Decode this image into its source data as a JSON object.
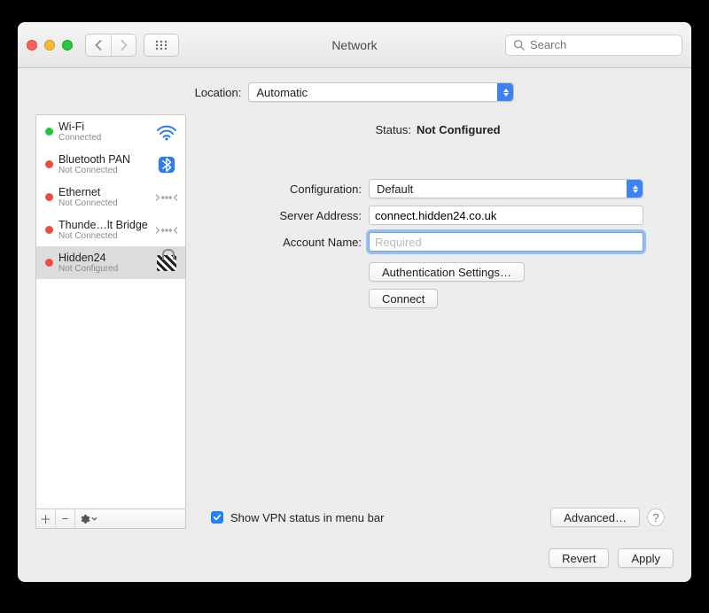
{
  "window": {
    "title": "Network"
  },
  "search": {
    "placeholder": "Search"
  },
  "location": {
    "label": "Location:",
    "value": "Automatic"
  },
  "colors": {
    "green": "#20c53f",
    "red": "#ea4d3d"
  },
  "sidebar": {
    "items": [
      {
        "name": "Wi-Fi",
        "sub": "Connected",
        "color": "#20c53f",
        "icon": "wifi-icon",
        "selected": false
      },
      {
        "name": "Bluetooth PAN",
        "sub": "Not Connected",
        "color": "#ea4d3d",
        "icon": "bluetooth-icon",
        "selected": false
      },
      {
        "name": "Ethernet",
        "sub": "Not Connected",
        "color": "#ea4d3d",
        "icon": "ethernet-icon",
        "selected": false
      },
      {
        "name": "Thunde…lt Bridge",
        "sub": "Not Connected",
        "color": "#ea4d3d",
        "icon": "ethernet-icon",
        "selected": false
      },
      {
        "name": "Hidden24",
        "sub": "Not Configured",
        "color": "#ea4d3d",
        "icon": "vpn-icon",
        "selected": true
      }
    ]
  },
  "panel": {
    "status_label": "Status:",
    "status_value": "Not Configured",
    "configuration_label": "Configuration:",
    "configuration_value": "Default",
    "server_label": "Server Address:",
    "server_value": "connect.hidden24.co.uk",
    "account_label": "Account Name:",
    "account_value": "",
    "account_placeholder": "Required",
    "auth_button": "Authentication Settings…",
    "connect_button": "Connect",
    "show_status_label": "Show VPN status in menu bar",
    "show_status_checked": true,
    "advanced_button": "Advanced…"
  },
  "buttons": {
    "revert": "Revert",
    "apply": "Apply"
  }
}
